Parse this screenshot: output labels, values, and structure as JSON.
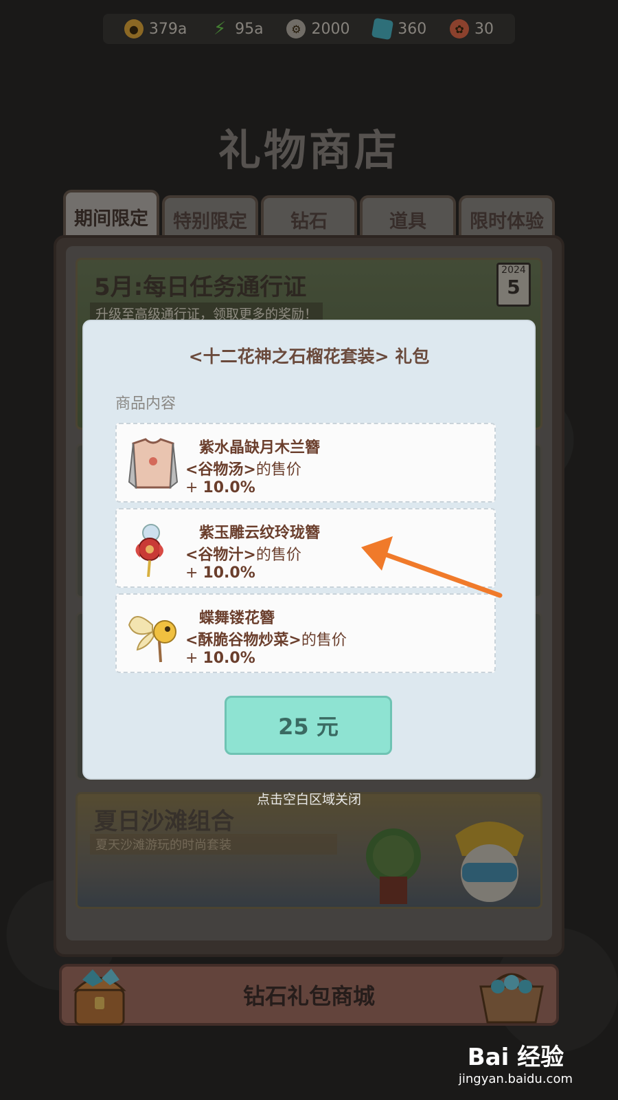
{
  "resources": [
    {
      "icon": "coin-icon",
      "value": "379a"
    },
    {
      "icon": "energy-icon",
      "value": "95a"
    },
    {
      "icon": "gear-icon",
      "value": "2000"
    },
    {
      "icon": "gem-icon",
      "value": "360"
    },
    {
      "icon": "ticket-icon",
      "value": "30"
    }
  ],
  "shop_title": "礼物商店",
  "tabs": [
    {
      "label": "期间限定",
      "active": true
    },
    {
      "label": "特别限定",
      "active": false
    },
    {
      "label": "钻石",
      "active": false
    },
    {
      "label": "道具",
      "active": false
    },
    {
      "label": "限时体验",
      "active": false
    }
  ],
  "banners": {
    "pass": {
      "title": "5月:每日任务通行证",
      "subtitle": "升级至高级通行证，领取更多的奖励！",
      "calendar_year": "2024",
      "calendar_day": "5"
    },
    "summer": {
      "title": "夏日沙滩组合",
      "subtitle": "夏天沙滩游玩的时尚套装"
    }
  },
  "diamond_shop_button": "钻石礼包商城",
  "modal": {
    "title": "<十二花神之石榴花套装> 礼包",
    "contents_label": "商品内容",
    "items": [
      {
        "name": "紫水晶缺月木兰簪",
        "target": "<谷物汤>",
        "suffix": "的售价",
        "bonus_sign": "+",
        "bonus": "10.0%"
      },
      {
        "name": "紫玉雕云纹玲珑簪",
        "target": "<谷物汁>",
        "suffix": "的售价",
        "bonus_sign": "+",
        "bonus": "10.0%"
      },
      {
        "name": "蝶舞镂花簪",
        "target": "<酥脆谷物炒菜>",
        "suffix": "的售价",
        "bonus_sign": "+",
        "bonus": "10.0%"
      }
    ],
    "price": "25 元"
  },
  "close_hint": "点击空白区域关闭",
  "watermark": {
    "top": "Bai 经验",
    "bottom": "jingyan.baidu.com"
  },
  "colors": {
    "price_button": "#8ee3d2",
    "arrow": "#f07a2a"
  }
}
